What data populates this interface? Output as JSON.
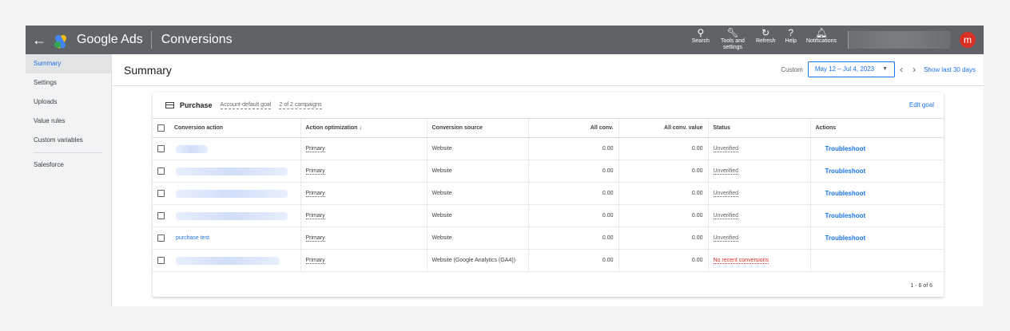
{
  "topbar": {
    "back_icon": "arrow-left-icon",
    "brand": "Google Ads",
    "page": "Conversions",
    "tools": [
      {
        "icon": "search-icon",
        "label": "Search"
      },
      {
        "icon": "wrench-icon",
        "label": "Tools and settings"
      },
      {
        "icon": "refresh-icon",
        "label": "Refresh"
      },
      {
        "icon": "help-icon",
        "label": "Help"
      },
      {
        "icon": "bell-icon",
        "label": "Notifications"
      }
    ],
    "avatar_letter": "m",
    "avatar_color": "#d93025"
  },
  "sidebar": {
    "items": [
      {
        "label": "Summary",
        "active": true
      },
      {
        "label": "Settings"
      },
      {
        "label": "Uploads"
      },
      {
        "label": "Value rules"
      },
      {
        "label": "Custom variables"
      },
      {
        "label": "Salesforce"
      }
    ]
  },
  "main": {
    "title": "Summary",
    "custom_label": "Custom",
    "date_range": "May 12 – Jul 4, 2023",
    "show_last": "Show last 30 days"
  },
  "card": {
    "title": "Purchase",
    "goal_meta": "Account-default goal",
    "campaigns_meta": "2 of 2 campaigns",
    "edit_label": "Edit goal",
    "columns": [
      "Conversion action",
      "Action optimization",
      "Conversion source",
      "All conv.",
      "All conv. value",
      "Status",
      "Actions"
    ],
    "rows": [
      {
        "name": "",
        "optimization": "Primary",
        "source": "Website",
        "conv": "0.00",
        "value": "0.00",
        "status": "Unverified",
        "action": "Troubleshoot"
      },
      {
        "name": "",
        "optimization": "Primary",
        "source": "Website",
        "conv": "0.00",
        "value": "0.00",
        "status": "Unverified",
        "action": "Troubleshoot"
      },
      {
        "name": "",
        "optimization": "Primary",
        "source": "Website",
        "conv": "0.00",
        "value": "0.00",
        "status": "Unverified",
        "action": "Troubleshoot"
      },
      {
        "name": "",
        "optimization": "Primary",
        "source": "Website",
        "conv": "0.00",
        "value": "0.00",
        "status": "Unverified",
        "action": "Troubleshoot"
      },
      {
        "name": "purchase test",
        "optimization": "Primary",
        "source": "Website",
        "conv": "0.00",
        "value": "0.00",
        "status": "Unverified",
        "action": "Troubleshoot"
      },
      {
        "name": "",
        "optimization": "Primary",
        "source": "Website (Google Analytics (GA4))",
        "conv": "0.00",
        "value": "0.00",
        "status": "No recent conversions",
        "action": ""
      }
    ],
    "pager": "1 - 6 of 6"
  }
}
